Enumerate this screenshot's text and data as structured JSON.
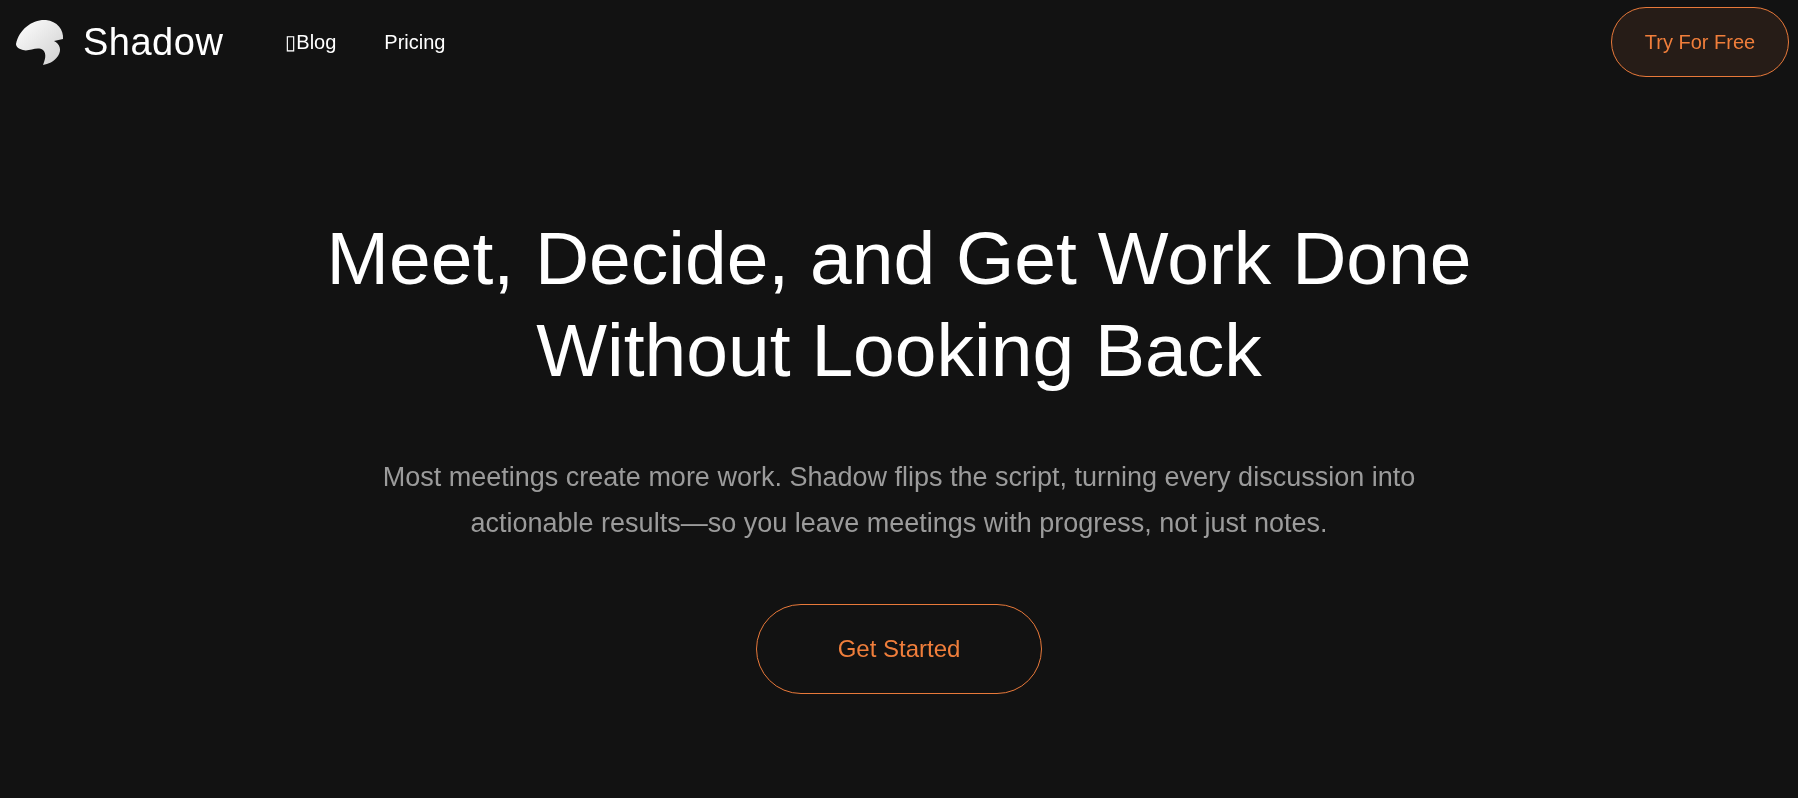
{
  "header": {
    "brand": "Shadow",
    "nav_links": [
      "▯Blog",
      "Pricing"
    ],
    "cta_button": "Try For Free"
  },
  "hero": {
    "headline": "Meet, Decide, and Get Work Done Without Looking Back",
    "subtitle": "Most meetings create more work. Shadow flips the script, turning every discussion into actionable results—so you leave meetings with progress, not just notes.",
    "button": "Get Started"
  }
}
